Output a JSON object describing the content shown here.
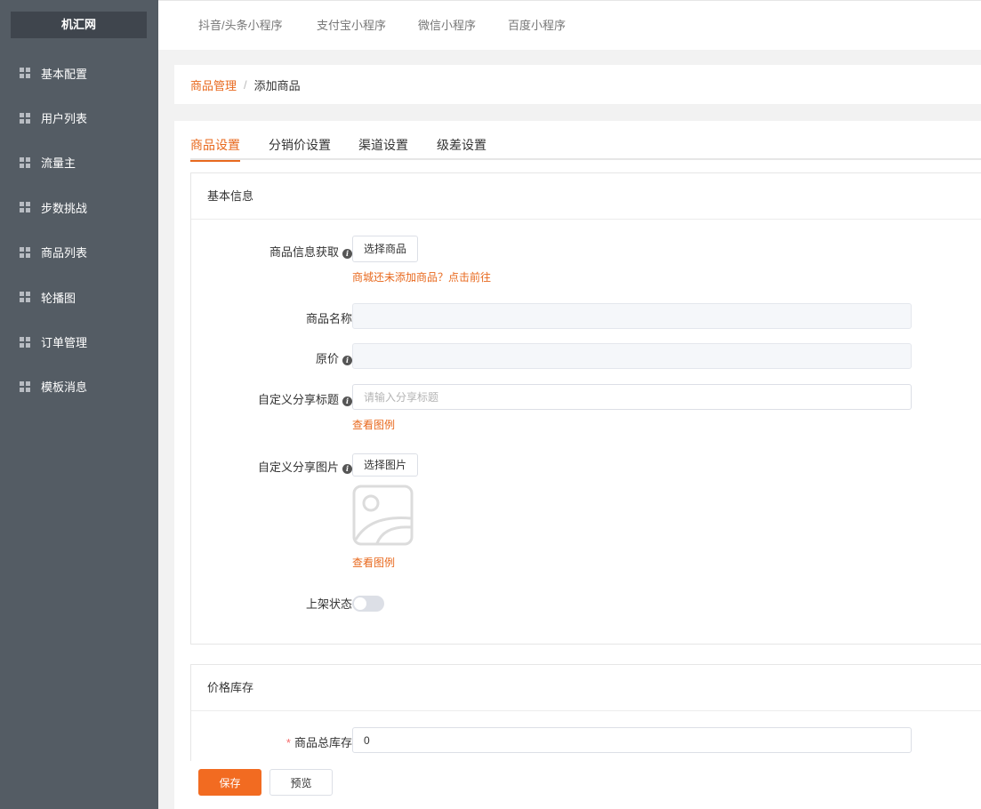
{
  "sidebar": {
    "logo": "机汇网",
    "items": [
      {
        "label": "基本配置"
      },
      {
        "label": "用户列表"
      },
      {
        "label": "流量主"
      },
      {
        "label": "步数挑战"
      },
      {
        "label": "商品列表"
      },
      {
        "label": "轮播图"
      },
      {
        "label": "订单管理"
      },
      {
        "label": "模板消息"
      }
    ]
  },
  "topbar": {
    "tabs": [
      "抖音/头条小程序",
      "支付宝小程序",
      "微信小程序",
      "百度小程序"
    ]
  },
  "breadcrumb": {
    "parent": "商品管理",
    "separator": "/",
    "current": "添加商品"
  },
  "tabs": [
    "商品设置",
    "分销价设置",
    "渠道设置",
    "级差设置"
  ],
  "basic": {
    "title": "基本信息",
    "product_fetch_label": "商品信息获取",
    "select_product_button": "选择商品",
    "no_product_hint": "商城还未添加商品？点击前往",
    "name_label": "商品名称",
    "name_value": "",
    "price_label": "原价",
    "price_value": "",
    "share_title_label": "自定义分享标题",
    "share_title_placeholder": "请输入分享标题",
    "view_example_1": "查看图例",
    "share_image_label": "自定义分享图片",
    "select_image_button": "选择图片",
    "view_example_2": "查看图例",
    "status_label": "上架状态",
    "status_on": false
  },
  "stock": {
    "title": "价格库存",
    "required_mark": "*",
    "total_stock_label": "商品总库存",
    "total_stock_value": "0"
  },
  "footer": {
    "save_label": "保存",
    "preview_label": "预览"
  },
  "colors": {
    "accent": "#e8691e",
    "primary_button": "#f26b21",
    "sidebar_bg": "#545c64"
  }
}
